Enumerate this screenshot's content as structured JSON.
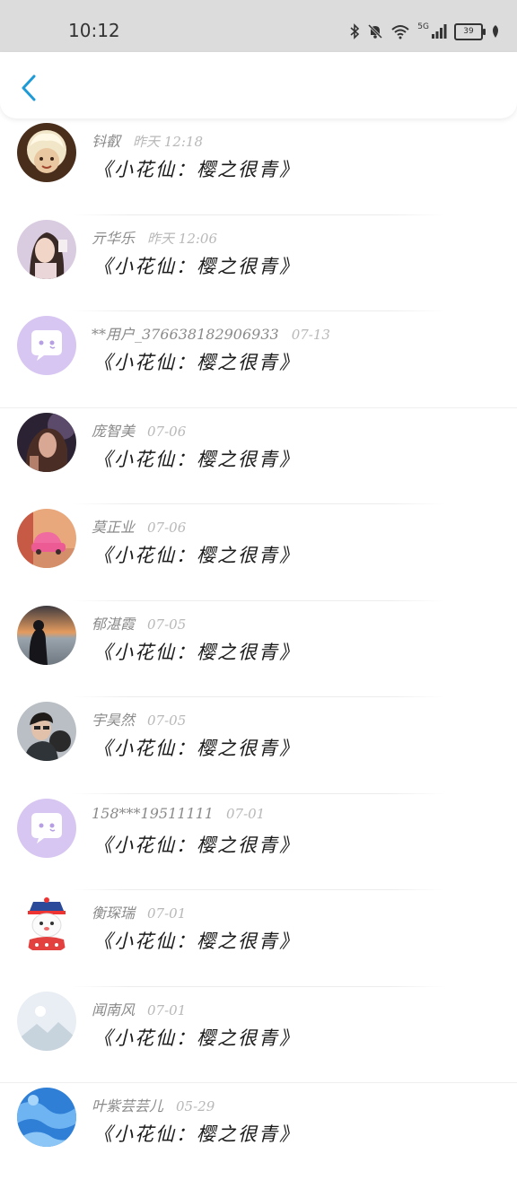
{
  "status_bar": {
    "time": "10:12",
    "network_label": "5G",
    "battery_level": "39",
    "icons": [
      "bluetooth-icon",
      "bell-muted-icon",
      "wifi-icon",
      "signal-icon",
      "battery-icon",
      "leaf-icon"
    ]
  },
  "header": {
    "back_icon": "chevron-left-icon",
    "accent_color": "#1e9bd7"
  },
  "comments": [
    {
      "name": "钭叡",
      "date": "昨天 12:18",
      "message": "《小花仙：樱之很青》",
      "avatar": "cartoon-girl-avatar"
    },
    {
      "name": "亓华乐",
      "date": "昨天 12:06",
      "message": "《小花仙：樱之很青》",
      "avatar": "portrait-girl-avatar"
    },
    {
      "name": "**用户_376638182906933",
      "date": "07-13",
      "message": "《小花仙：樱之很青》",
      "avatar": "default-chat-avatar"
    },
    {
      "name": "庞智美",
      "date": "07-06",
      "message": "《小花仙：樱之很青》",
      "avatar": "portrait-avatar"
    },
    {
      "name": "莫正业",
      "date": "07-06",
      "message": "《小花仙：樱之很青》",
      "avatar": "pink-car-avatar"
    },
    {
      "name": "郁湛霞",
      "date": "07-05",
      "message": "《小花仙：樱之很青》",
      "avatar": "sunset-girl-avatar"
    },
    {
      "name": "宇昊然",
      "date": "07-05",
      "message": "《小花仙：樱之很青》",
      "avatar": "man-portrait-avatar"
    },
    {
      "name": "158***19511111",
      "date": "07-01",
      "message": "《小花仙：樱之很青》",
      "avatar": "default-chat-avatar"
    },
    {
      "name": "衡琛瑞",
      "date": "07-01",
      "message": "《小花仙：樱之很青》",
      "avatar": "cartoon-snowman-avatar"
    },
    {
      "name": "闻南风",
      "date": "07-01",
      "message": "《小花仙：樱之很青》",
      "avatar": "placeholder-image-avatar"
    },
    {
      "name": "叶紫芸芸儿",
      "date": "05-29",
      "message": "《小花仙：樱之很青》",
      "avatar": "blue-texture-avatar"
    }
  ]
}
